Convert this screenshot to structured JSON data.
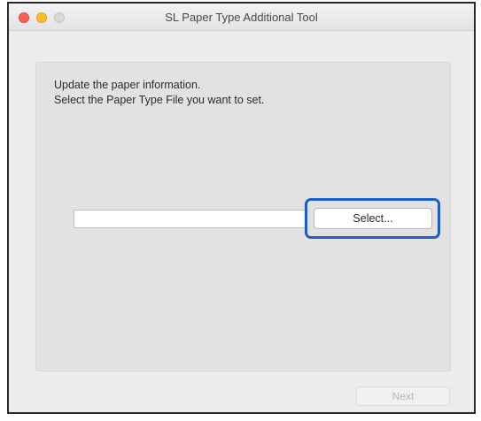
{
  "window": {
    "title": "SL Paper Type Additional Tool"
  },
  "content": {
    "instruction_line1": "Update the paper information.",
    "instruction_line2": "Select the Paper Type File you want to set.",
    "file_path_value": "",
    "select_button_label": "Select...",
    "highlight_color": "#1e5fc5"
  },
  "footer": {
    "next_button_label": "Next",
    "next_button_enabled": false
  },
  "traffic_lights": {
    "close_color": "#fe5f57",
    "minimize_color": "#febc2e",
    "zoom_color": "#d9d9d9"
  }
}
